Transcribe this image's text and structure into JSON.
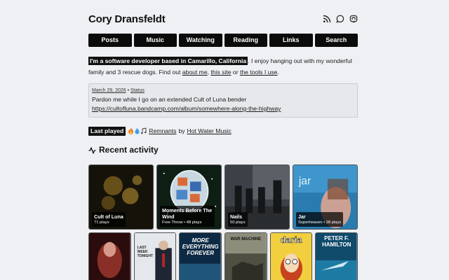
{
  "header": {
    "title": "Cory Dransfeldt",
    "icons": [
      "rss-icon",
      "chat-icon",
      "mastodon-icon"
    ]
  },
  "nav": [
    {
      "label": "Posts"
    },
    {
      "label": "Music"
    },
    {
      "label": "Watching"
    },
    {
      "label": "Reading"
    },
    {
      "label": "Links"
    },
    {
      "label": "Search"
    }
  ],
  "intro": {
    "highlight": "I'm a software developer based in Camarillo, California",
    "text1": ". I enjoy hanging out with my wonderful family and 3 rescue dogs. Find out ",
    "link_about": "about me",
    "text2": ", ",
    "link_site": "this site",
    "text3": " or ",
    "link_tools": "the tools I use",
    "text4": "."
  },
  "status": {
    "date": "March 29, 2026",
    "separator": " • ",
    "label": "Status",
    "text": "Pardon me while I go on an extended Cult of Luna bender",
    "url": "https://cultofluna.bandcamp.com/album/somewhere-along-the-highway"
  },
  "last_played": {
    "badge": "Last played",
    "emoji": [
      "fire",
      "droplet",
      "notes"
    ],
    "track": "Remnants",
    "by": "by",
    "artist": "Hot Water Music"
  },
  "recent": {
    "title": "Recent activity",
    "albums": [
      {
        "title": "Cult of Luna",
        "sub": "71 plays",
        "colors": [
          "#1b1608",
          "#c9a13a"
        ]
      },
      {
        "title": "Moments Before The Wind",
        "sub": "Free Throw • 48 plays",
        "colors": [
          "#0d1a12",
          "#d86a3a"
        ]
      },
      {
        "title": "Nails",
        "sub": "50 plays",
        "colors": [
          "#2b2f33",
          "#8c9196"
        ]
      },
      {
        "title": "Jar",
        "sub": "Superheaven • 28 plays",
        "colors": [
          "#1f6a9c",
          "#7fc4e6"
        ]
      }
    ],
    "books": [
      {
        "title": "",
        "colors": [
          "#3a0f0f",
          "#b0453a"
        ]
      },
      {
        "title": "LAST WEEK TONIGHT",
        "colors": [
          "#dfe3e8",
          "#222a3a"
        ]
      },
      {
        "title": "MORE EVERYTHING FOREVER",
        "colors": [
          "#0e2e4a",
          "#2f6a8f"
        ]
      },
      {
        "title": "WAR MACHINE",
        "colors": [
          "#5a5a4c",
          "#a0a08a"
        ]
      },
      {
        "title": "daria",
        "colors": [
          "#f4d34a",
          "#2a2a2a"
        ]
      },
      {
        "title": "PETER F. HAMILTON",
        "colors": [
          "#0f4a6a",
          "#3fa0c8"
        ]
      }
    ]
  }
}
